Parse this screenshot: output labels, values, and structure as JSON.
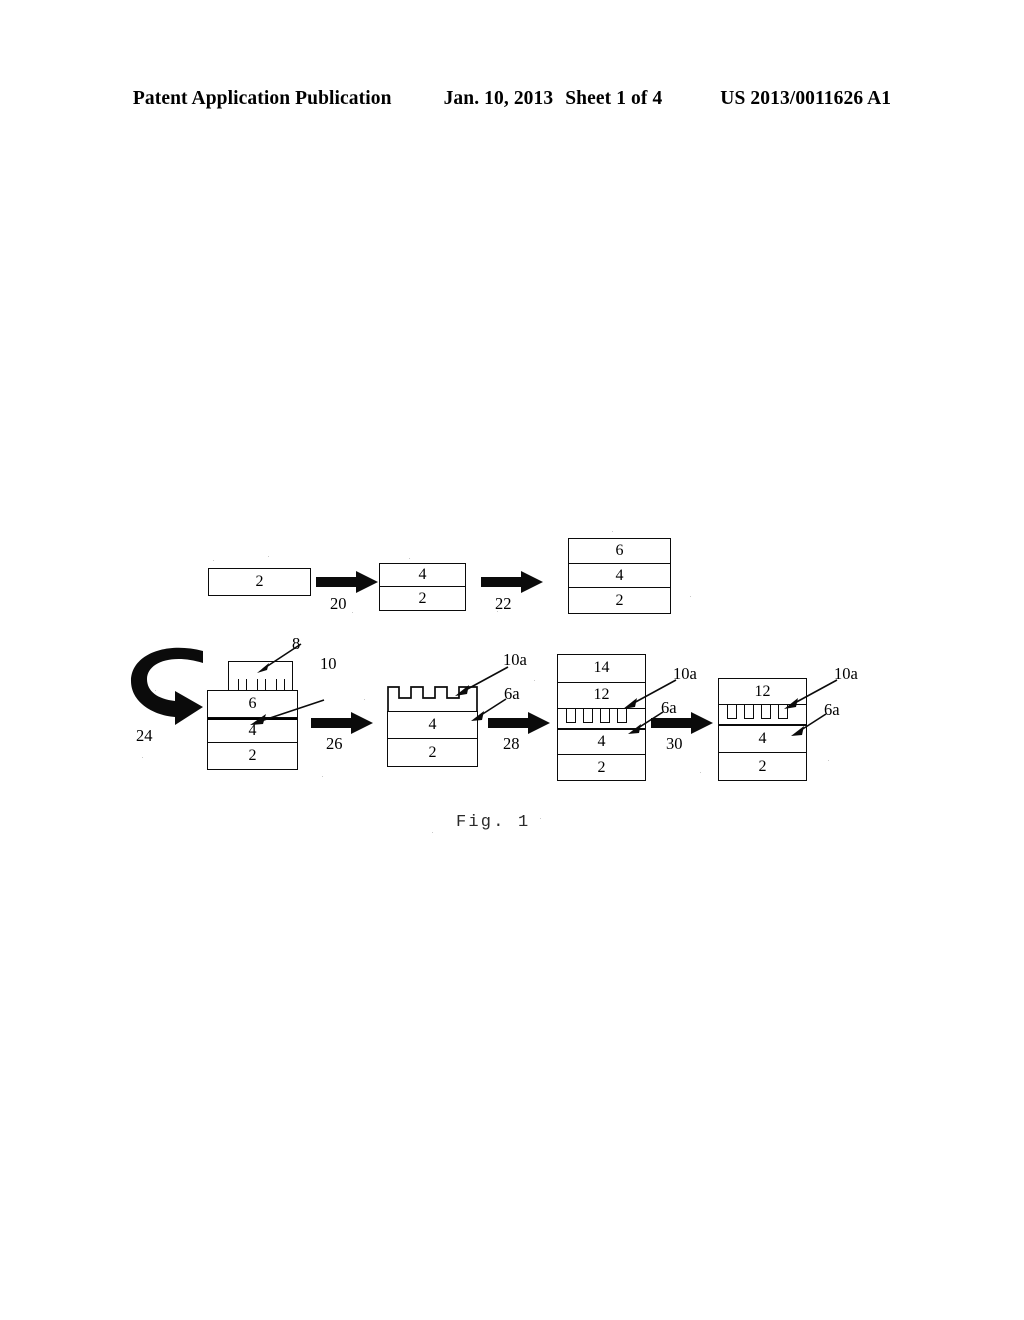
{
  "header": {
    "publication": "Patent Application Publication",
    "date": "Jan. 10, 2013",
    "sheet": "Sheet 1 of 4",
    "patent_number": "US 2013/0011626 A1"
  },
  "figure": {
    "caption": "Fig. 1",
    "ink_color": "#0b0b0b",
    "background_color": "#ffffff",
    "process_arrows": [
      {
        "id": "arrow-20",
        "label": "20"
      },
      {
        "id": "arrow-22",
        "label": "22"
      },
      {
        "id": "arrow-24",
        "label": "24",
        "shape": "curved-wrap"
      },
      {
        "id": "arrow-26",
        "label": "26"
      },
      {
        "id": "arrow-28",
        "label": "28"
      },
      {
        "id": "arrow-30",
        "label": "30"
      }
    ],
    "stacks": [
      {
        "id": "stack-1",
        "layers": [
          {
            "label": "2"
          }
        ]
      },
      {
        "id": "stack-2",
        "layers": [
          {
            "label": "4"
          },
          {
            "label": "2"
          }
        ]
      },
      {
        "id": "stack-3",
        "layers": [
          {
            "label": "6"
          },
          {
            "label": "4"
          },
          {
            "label": "2"
          }
        ]
      },
      {
        "id": "stack-4",
        "layers": [
          {
            "label": "6"
          },
          {
            "label": "4"
          },
          {
            "label": "2"
          }
        ],
        "stamp": {
          "label": "8",
          "teeth": 3
        },
        "callouts": [
          {
            "label": "8"
          },
          {
            "label": "10"
          }
        ]
      },
      {
        "id": "stack-5",
        "grooved_layer": {
          "label": "6a",
          "grooves": 4
        },
        "layers": [
          {
            "label": "4"
          },
          {
            "label": "2"
          }
        ],
        "callouts": [
          {
            "label": "10a"
          },
          {
            "label": "6a"
          }
        ]
      },
      {
        "id": "stack-6",
        "layers": [
          {
            "label": "14"
          },
          {
            "label": "12"
          }
        ],
        "cavity_layer": {
          "label": "6a",
          "cavities": 4
        },
        "lower_layers": [
          {
            "label": "4"
          },
          {
            "label": "2"
          }
        ],
        "callouts": [
          {
            "label": "10a"
          },
          {
            "label": "6a"
          }
        ]
      },
      {
        "id": "stack-7",
        "layers": [
          {
            "label": "12"
          }
        ],
        "cavity_layer": {
          "label": "6a",
          "cavities": 4
        },
        "lower_layers": [
          {
            "label": "4"
          },
          {
            "label": "2"
          }
        ],
        "callouts": [
          {
            "label": "10a"
          },
          {
            "label": "6a"
          }
        ]
      }
    ],
    "labels": {
      "l8": "8",
      "l10": "10",
      "l10a_b": "10a",
      "l6a_b": "6a",
      "l10a_c": "10a",
      "l6a_c": "6a",
      "l10a_d": "10a",
      "l6a_d": "6a",
      "l20": "20",
      "l22": "22",
      "l24": "24",
      "l26": "26",
      "l28": "28",
      "l30": "30",
      "s1_2": "2",
      "s2_4": "4",
      "s2_2": "2",
      "s3_6": "6",
      "s3_4": "4",
      "s3_2": "2",
      "s4_6": "6",
      "s4_4": "4",
      "s4_2": "2",
      "s5_4": "4",
      "s5_2": "2",
      "s6_14": "14",
      "s6_12": "12",
      "s6_4": "4",
      "s6_2": "2",
      "s7_12": "12",
      "s7_4": "4",
      "s7_2": "2"
    }
  }
}
